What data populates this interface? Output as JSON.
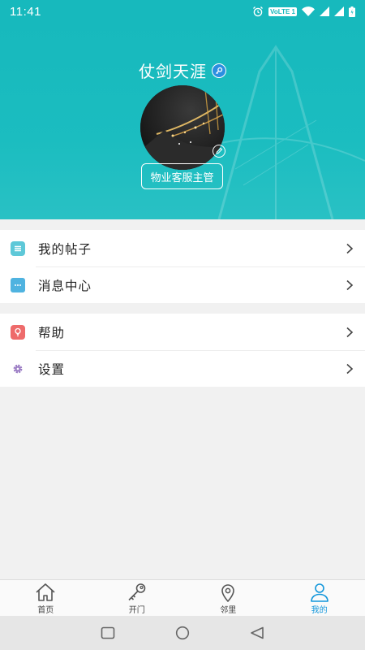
{
  "status_bar": {
    "time": "11:41",
    "network_label": "VoLTE 1"
  },
  "profile": {
    "username": "仗剑天涯",
    "role": "物业客服主管",
    "verified_icon": "verified-key-icon",
    "avatar_icon": "night-city-avatar"
  },
  "menu_groups": [
    {
      "items": [
        {
          "label": "我的帖子",
          "icon": "posts-icon",
          "color": "#5ec8d8"
        },
        {
          "label": "消息中心",
          "icon": "message-icon",
          "color": "#4fb3e0"
        }
      ]
    },
    {
      "items": [
        {
          "label": "帮助",
          "icon": "help-bulb-icon",
          "color": "#ee6b6b"
        },
        {
          "label": "设置",
          "icon": "settings-gear-icon",
          "color": "#9b7cc4"
        }
      ]
    }
  ],
  "bottom_nav": {
    "items": [
      {
        "label": "首页",
        "icon": "home-icon"
      },
      {
        "label": "开门",
        "icon": "key-icon"
      },
      {
        "label": "邻里",
        "icon": "location-pin-icon"
      },
      {
        "label": "我的",
        "icon": "user-icon",
        "active": true
      }
    ]
  },
  "colors": {
    "accent": "#17b9bd",
    "active_tab": "#1296db"
  }
}
